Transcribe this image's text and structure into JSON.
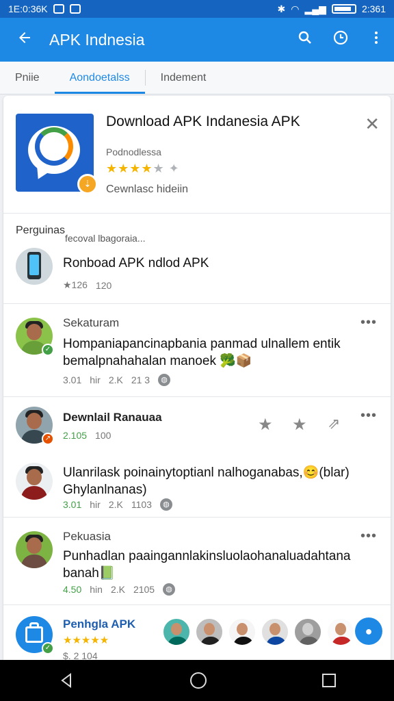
{
  "status_bar": {
    "time": "1E:0:36K",
    "clock": "2:361"
  },
  "app_bar": {
    "title": "APK Indnesia",
    "icons": [
      "back-arrow-icon",
      "search-icon",
      "history-icon",
      "more-vert-icon"
    ]
  },
  "tabs": [
    {
      "label": "Pniie",
      "active": false
    },
    {
      "label": "Aondoetalss",
      "active": true
    },
    {
      "label": "Indement",
      "active": false
    }
  ],
  "app_card": {
    "title": "Download APK Indanesia APK",
    "developer": "Podnodlessa",
    "stars": "★★★★",
    "stars_off": "★ ✦",
    "downloads": "Cewnlasc hideiin"
  },
  "section": {
    "heading": "Perguinas",
    "subheading": "fecoval lbagoraia..."
  },
  "featured": {
    "title": "Ronboad APK ndlod APK",
    "rating": "★126",
    "count": "120"
  },
  "posts": [
    {
      "author": "Sekaturam",
      "text": "Hompaniapancinapbania panmad ulnallem entik bemalpnahahalan manoek 🥦📦",
      "meta_a": "3.01",
      "meta_b": "hir",
      "meta_c": "2.K",
      "meta_d": "21 3"
    },
    {
      "author": "Dewnlail Ranauaa",
      "rating": "2.105",
      "count": "100"
    },
    {
      "text": "Ulanrilask poinainytoptianl nalhoganabas,😊(blar) Ghylanlnanas)",
      "meta_a": "3.01",
      "meta_b": "hir",
      "meta_c": "2.K",
      "meta_d": "1103"
    },
    {
      "author": "Pekuasia",
      "text": "Punhadlan paaingannlakinsluolaohanaluadahtana banah📗",
      "meta_a": "4.50",
      "meta_b": "hin",
      "meta_c": "2.K",
      "meta_d": "2105"
    }
  ],
  "bottom": {
    "title": "Penhgla APK",
    "stars": "★★★★★",
    "count": "$. 2    104"
  },
  "colors": {
    "primary": "#1e88e5",
    "status_bar": "#1565c0",
    "star": "#f4b400"
  }
}
